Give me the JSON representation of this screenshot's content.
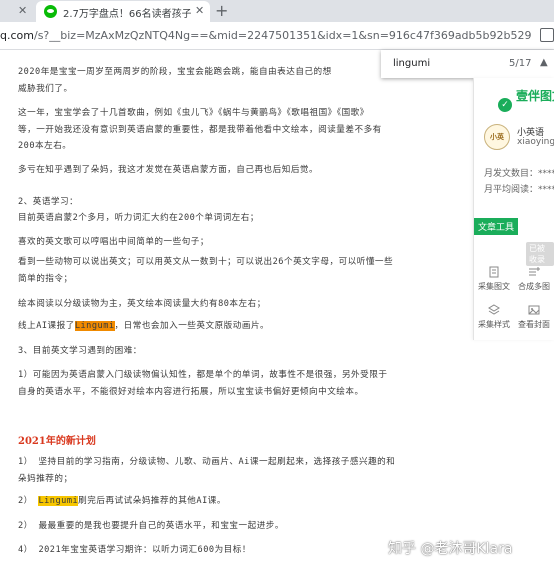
{
  "browser": {
    "tabs": [
      {
        "title": "2.7万字盘点！66名读者孩子的20",
        "active": true
      }
    ],
    "url_host": "q.com",
    "url_rest": "/s?__biz=MzAxMzQzNTQ4Ng==&mid=2247501351&idx=1&sn=916c47f369adb5b92b529ef8fca...",
    "find": {
      "query": "lingumi",
      "count": "5/17"
    }
  },
  "article": {
    "p1": {
      "l1": "2020年是宝宝一周岁至两周岁的阶段，宝宝会能跑会跳，能自由表达自己的想",
      "l2": "威胁我们了。"
    },
    "p2": {
      "l1": "这一年，宝宝学会了十几首歌曲，例如《虫儿飞》《蜗牛与黄鹂鸟》《歌唱祖国》《国歌》",
      "l2": "等，一开始我还没有意识到英语启蒙的重要性，都是我带着他看中文绘本，阅读量差不多有",
      "l3": "200本左右。"
    },
    "p3": "多亏在知乎遇到了朵妈，我这才发觉在英语启蒙方面，自己再也后知后觉。",
    "h_english": "2、英语学习：",
    "p4": "目前英语启蒙2个多月，听力词汇大约在200个单词词左右；",
    "p5": "喜欢的英文歌可以哼唱出中间简单的一些句子；",
    "p6": {
      "l1": "看到一些动物可以说出英文；可以用英文从一数到十；可以说出26个英文字母，可以听懂一些",
      "l2": "简单的指令；"
    },
    "p7": "绘本阅读以分级读物为主，英文绘本阅读量大约有80本左右；",
    "p8": {
      "pre": "线上AI课报了",
      "hl": "Lingumi",
      "post": "，日常也会加入一些英文原版动画片。"
    },
    "h_problem": "3、目前英文学习遇到的困难：",
    "p9": {
      "l1": "1）可能因为英语启蒙入门级读物偏认知性，都是单个的单词，故事性不是很强，另外受限于",
      "l2": "自身的英语水平，不能很好对绘本内容进行拓展，所以宝宝读书偏好更倾向中文绘本。"
    },
    "heading_2021": "2021年的新计划",
    "plan1": {
      "l1": "1）  坚持目前的学习指南，分级读物、儿歌、动画片、Ai课一起刷起来，选择孩子感兴趣的和",
      "l2": "朵妈推荐的；"
    },
    "plan2": {
      "hl": "Lingumi",
      "post": "刷完后再试试朵妈推荐的其他AI课。"
    },
    "plan3": "2）  最最重要的是我也要提升自己的英语水平，和宝宝一起进步。",
    "plan4": "4）  2021年宝宝英语学习期许：以听力词汇600为目标！"
  },
  "sidebar": {
    "logo_mark": "✓",
    "logo_text": "壹伴图文",
    "avatar_text": "小英",
    "account_name": "小英语",
    "account_id": "xiaoyingy",
    "stat1": "月发文数目：****",
    "stat2": "月平均阅读：****",
    "tools_tag": "文章工具",
    "badge_ghost": "已被收录",
    "tools": [
      {
        "label": "采集图文",
        "icon": "doc-icon"
      },
      {
        "label": "合成多图",
        "icon": "merge-icon"
      },
      {
        "label": "采集样式",
        "icon": "layers-icon"
      },
      {
        "label": "查看封面",
        "icon": "image-icon"
      }
    ]
  },
  "watermark": "知乎 @老沐哥Klara"
}
